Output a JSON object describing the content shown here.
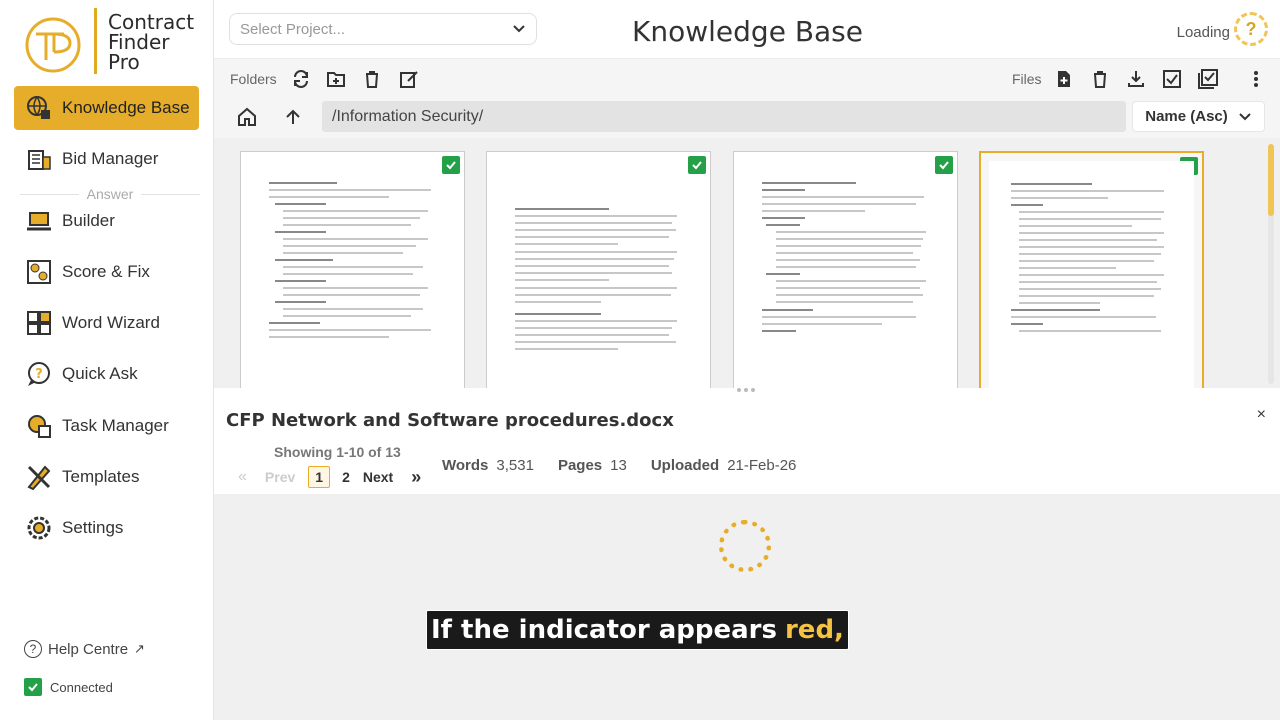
{
  "app": {
    "name_line1": "Contract",
    "name_line2": "Finder",
    "name_line3": "Pro"
  },
  "sidebar": {
    "items": [
      {
        "label": "Knowledge Base",
        "icon": "globe-icon",
        "active": true
      },
      {
        "label": "Bid Manager",
        "icon": "building-icon"
      },
      {
        "label": "Builder",
        "icon": "laptop-icon"
      },
      {
        "label": "Score & Fix",
        "icon": "score-icon"
      },
      {
        "label": "Word Wizard",
        "icon": "grid-icon"
      },
      {
        "label": "Quick Ask",
        "icon": "question-bubble-icon"
      },
      {
        "label": "Task Manager",
        "icon": "task-gear-icon"
      },
      {
        "label": "Templates",
        "icon": "pencil-ruler-icon"
      },
      {
        "label": "Settings",
        "icon": "gear-icon"
      }
    ],
    "section_label": "Answer",
    "help_label": "Help Centre",
    "connected_label": "Connected"
  },
  "header": {
    "project_placeholder": "Select Project...",
    "title": "Knowledge Base",
    "status": "Loading"
  },
  "toolbar": {
    "folders_label": "Folders",
    "files_label": "Files"
  },
  "pathbar": {
    "path": "/Information Security/",
    "sort": "Name (Asc)"
  },
  "documents": [
    {
      "name": "doc-1",
      "checked": true
    },
    {
      "name": "doc-2",
      "checked": true
    },
    {
      "name": "doc-3",
      "checked": true
    },
    {
      "name": "doc-4",
      "checked": true,
      "selected": true
    }
  ],
  "preview": {
    "file_name": "CFP Network and Software procedures.docx",
    "close": "×",
    "showing": "Showing 1-10 of 13",
    "prev": "Prev",
    "pages": [
      "1",
      "2"
    ],
    "next": "Next",
    "words_label": "Words",
    "words_value": "3,531",
    "pages_label": "Pages",
    "pages_value": "13",
    "uploaded_label": "Uploaded",
    "uploaded_value": "21-Feb-26"
  },
  "caption": {
    "text": "If the indicator appears",
    "highlight": "red,"
  },
  "colors": {
    "accent": "#e6ad2a",
    "check": "#24a148"
  }
}
